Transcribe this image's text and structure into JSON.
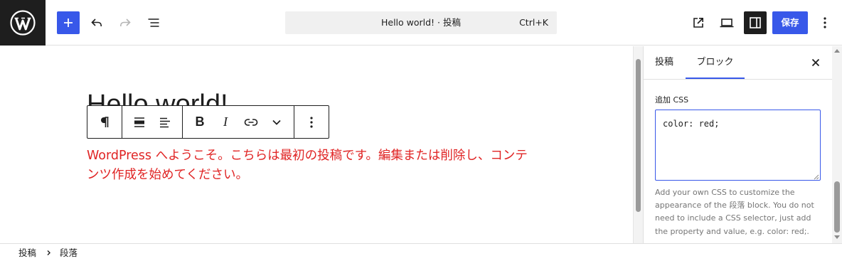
{
  "topbar": {
    "logo_icon": "wordpress-logo",
    "add_block_icon": "plus-icon",
    "undo_icon": "undo-icon",
    "redo_icon": "redo-icon",
    "document_overview_icon": "list-view-icon",
    "command_title": "Hello world! · 投稿",
    "command_shortcut": "Ctrl+K",
    "view_post_icon": "external-link-icon",
    "preview_icon": "laptop-icon",
    "settings_icon": "sidebar-toggle-icon",
    "save_label": "保存",
    "options_icon": "more-vertical-icon",
    "accent_color": "#3858e9"
  },
  "canvas": {
    "post_title": "Hello world!",
    "paragraph_text": "WordPress へようこそ。こちらは最初の投稿です。編集または削除し、コンテンツ作成を始めてください。",
    "paragraph_color": "#e02424"
  },
  "block_toolbar": {
    "block_type_icon": "paragraph-icon",
    "align_icon": "align-center-icon",
    "text_align_icon": "align-left-icon",
    "bold_label": "B",
    "italic_label": "I",
    "link_icon": "link-icon",
    "more_formats_icon": "chevron-down-icon",
    "options_icon": "more-vertical-icon"
  },
  "sidebar": {
    "tabs": [
      {
        "label": "投稿",
        "active": false
      },
      {
        "label": "ブロック",
        "active": true
      }
    ],
    "close_icon": "close-icon",
    "css_label": "追加 CSS",
    "css_value": "color: red;",
    "css_help": "Add your own CSS to customize the appearance of the 段落 block. You do not need to include a CSS selector, just add the property and value, e.g. color: red;."
  },
  "breadcrumb": {
    "items": [
      "投稿",
      "段落"
    ],
    "separator_icon": "chevron-right-icon"
  }
}
